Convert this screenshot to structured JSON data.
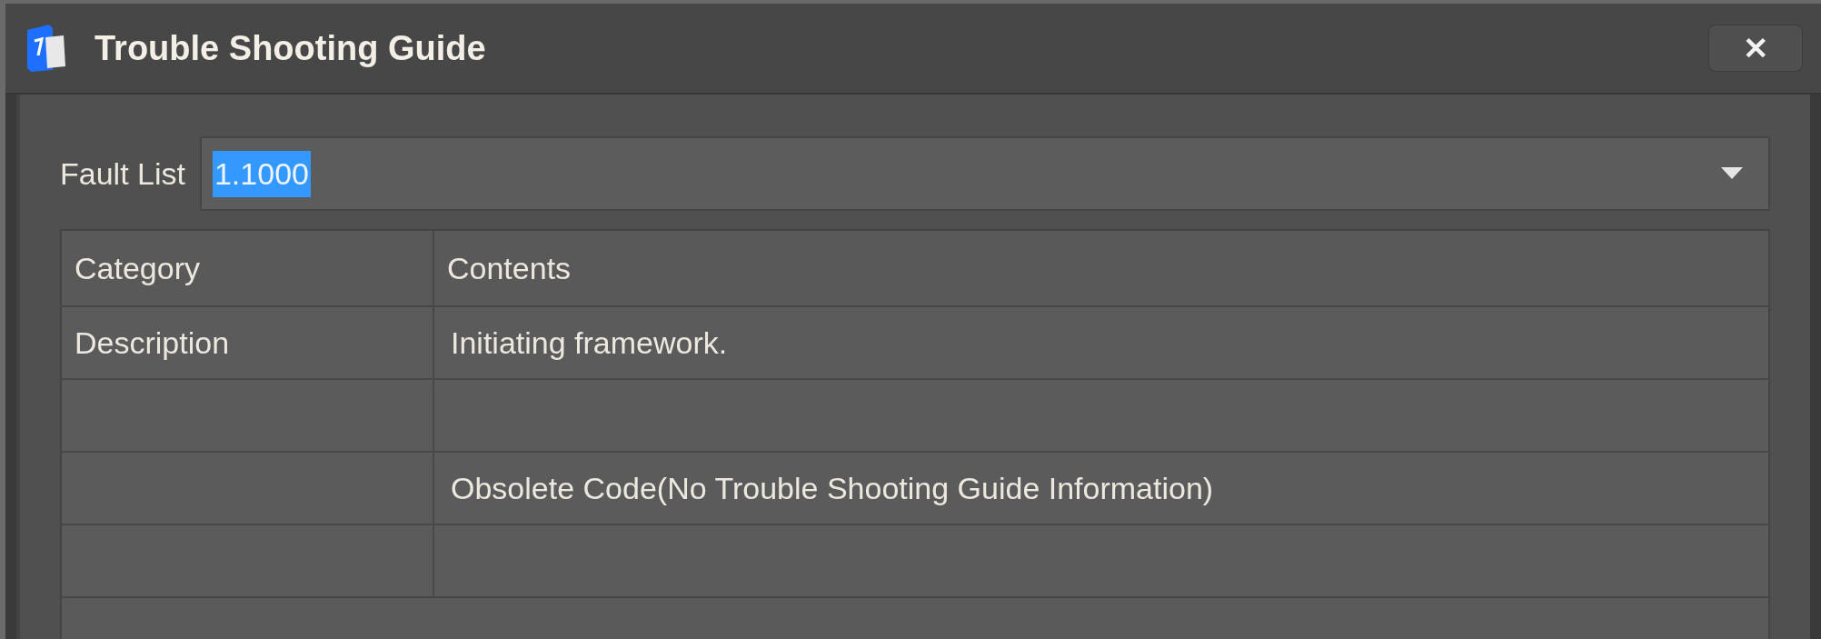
{
  "window": {
    "title": "Trouble Shooting Guide",
    "close": "✕"
  },
  "fault_list": {
    "label": "Fault List",
    "value": "1.1000",
    "selected": true
  },
  "table": {
    "columns": [
      "Category",
      "Contents"
    ],
    "rows": [
      {
        "category": "Description",
        "contents": "Initiating framework."
      },
      {},
      {
        "contents": "Obsolete Code(No Trouble Shooting Guide Information)"
      },
      {}
    ]
  }
}
